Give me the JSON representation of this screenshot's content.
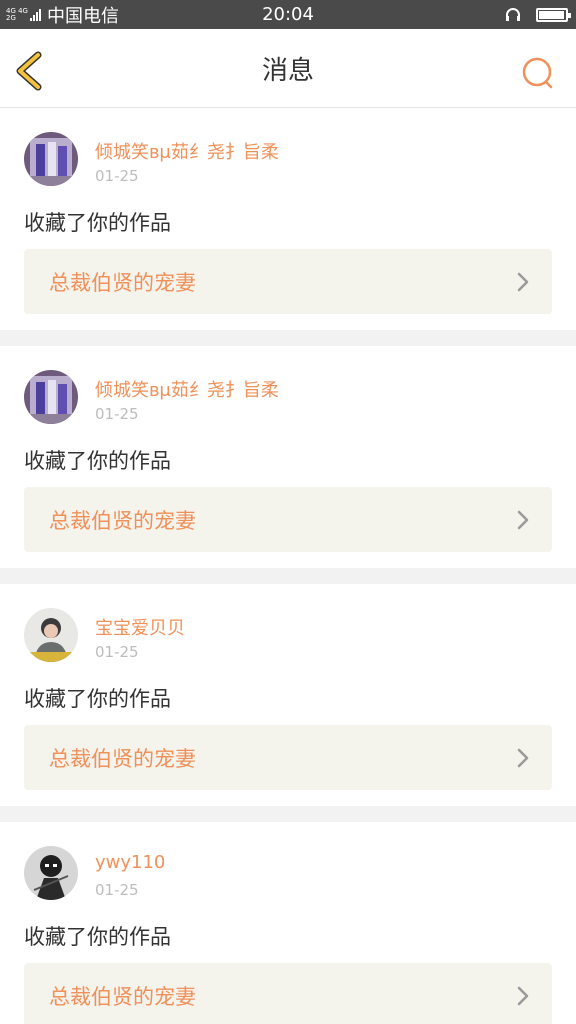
{
  "status_bar": {
    "network_top": "4G 4G",
    "network_bottom": "2G",
    "carrier": "中国电信",
    "time": "20:04",
    "icons": [
      "signal-icon",
      "headset-icon",
      "battery-icon"
    ],
    "battery_level": 0.95
  },
  "header": {
    "title": "消息",
    "back_icon": "chevron-left-icon",
    "search_icon": "search-icon"
  },
  "colors": {
    "accent": "#f0915a",
    "back_arrow": "#f5c23b",
    "card_link_bg": "#f4f3ec",
    "status_bar": "#4a4a4a"
  },
  "messages": [
    {
      "username": "倾城笑ʙμ茹纟尧扌旨柔",
      "date": "01-25",
      "action": "收藏了你的作品",
      "work_title": "总裁伯贤的宠妻"
    },
    {
      "username": "倾城笑ʙμ茹纟尧扌旨柔",
      "date": "01-25",
      "action": "收藏了你的作品",
      "work_title": "总裁伯贤的宠妻"
    },
    {
      "username": "宝宝爱贝贝",
      "date": "01-25",
      "action": "收藏了你的作品",
      "work_title": "总裁伯贤的宠妻"
    },
    {
      "username": "ywy110",
      "date": "01-25",
      "action": "收藏了你的作品",
      "work_title": "总裁伯贤的宠妻"
    }
  ]
}
